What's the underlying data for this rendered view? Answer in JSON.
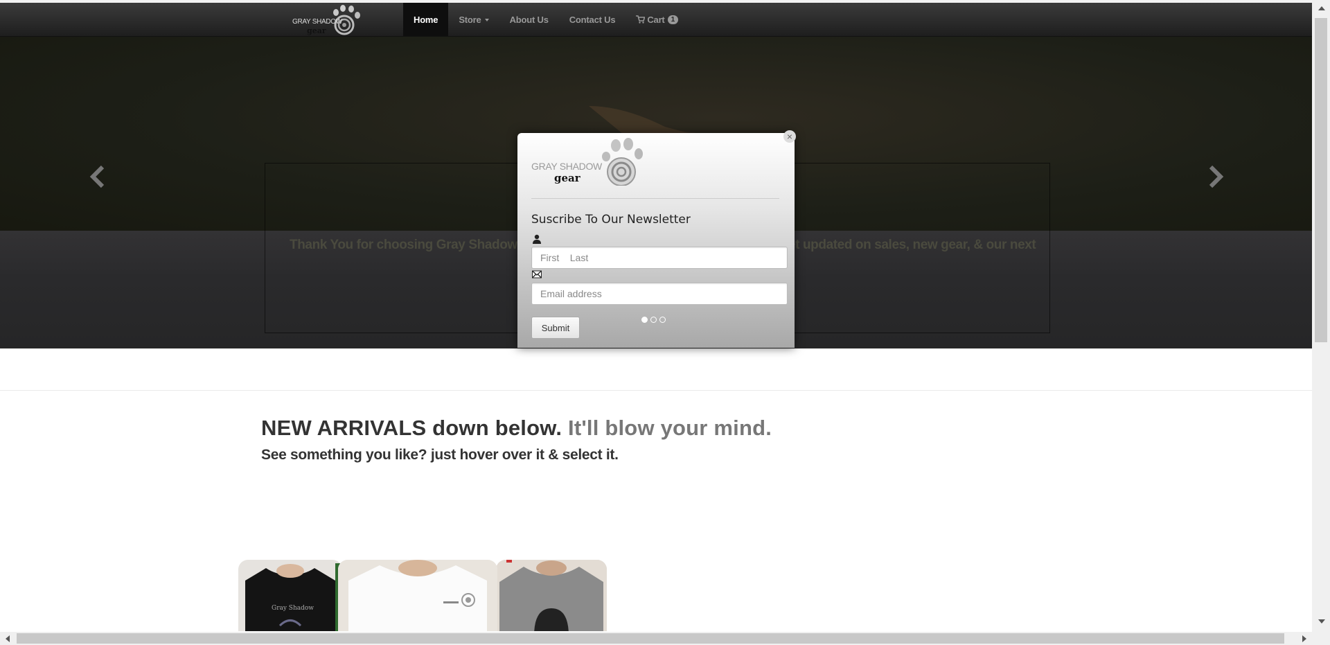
{
  "navbar": {
    "logo_text": "GRAY SHADOW",
    "logo_subtext": "gear",
    "items": [
      {
        "label": "Home",
        "active": true
      },
      {
        "label": "Store",
        "dropdown": true
      },
      {
        "label": "About Us"
      },
      {
        "label": "Contact Us"
      },
      {
        "label": "Cart",
        "icon": "cart-icon",
        "count": "1"
      }
    ]
  },
  "hero": {
    "caption_left": "Thank You for choosing Gray Shadow Gea",
    "caption_right": "et updated on sales, new gear, & our next",
    "prev_icon": "chevron-left-icon",
    "next_icon": "chevron-right-icon",
    "indicators": 3,
    "active_indicator": 0
  },
  "modal": {
    "logo_text": "GRAY SHADOW",
    "logo_subtext": "gear",
    "close_label": "×",
    "title": "Suscribe To Our Newsletter",
    "name_placeholder": "First    Last",
    "email_placeholder": "Email address",
    "submit_label": "Submit",
    "name_icon": "user-icon",
    "email_icon": "envelope-icon"
  },
  "main": {
    "headline_strong": "NEW ARRIVALS",
    "headline_rest": " down below. ",
    "headline_gray": "It'll blow your mind.",
    "subheadline": "See something you like? just hover over it & select it.",
    "product_shirt_text": "Gray Shadow"
  },
  "colors": {
    "navbar": "#2a2a2a",
    "nav_active": "#0e0e0e",
    "text_dark": "#333333",
    "text_gray": "#777777"
  }
}
